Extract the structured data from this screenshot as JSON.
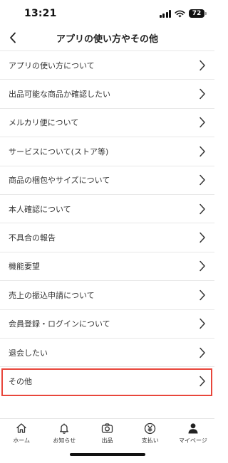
{
  "status_bar": {
    "time": "13:21",
    "battery": "72"
  },
  "header": {
    "title": "アプリの使い方やその他"
  },
  "menu": {
    "items": [
      {
        "label": "アプリの使い方について"
      },
      {
        "label": "出品可能な商品か確認したい"
      },
      {
        "label": "メルカリ便について"
      },
      {
        "label": "サービスについて(ストア等)"
      },
      {
        "label": "商品の梱包やサイズについて"
      },
      {
        "label": "本人確認について"
      },
      {
        "label": "不具合の報告"
      },
      {
        "label": "機能要望"
      },
      {
        "label": "売上の振込申請について"
      },
      {
        "label": "会員登録・ログインについて"
      },
      {
        "label": "退会したい"
      },
      {
        "label": "その他",
        "highlighted": true
      }
    ]
  },
  "tab_bar": {
    "tabs": [
      {
        "label": "ホーム",
        "icon": "home-icon"
      },
      {
        "label": "お知らせ",
        "icon": "bell-icon"
      },
      {
        "label": "出品",
        "icon": "camera-icon"
      },
      {
        "label": "支払い",
        "icon": "yen-icon"
      },
      {
        "label": "マイページ",
        "icon": "person-icon"
      }
    ]
  },
  "colors": {
    "highlight": "#e8463b",
    "divider": "#e8e8e8"
  }
}
